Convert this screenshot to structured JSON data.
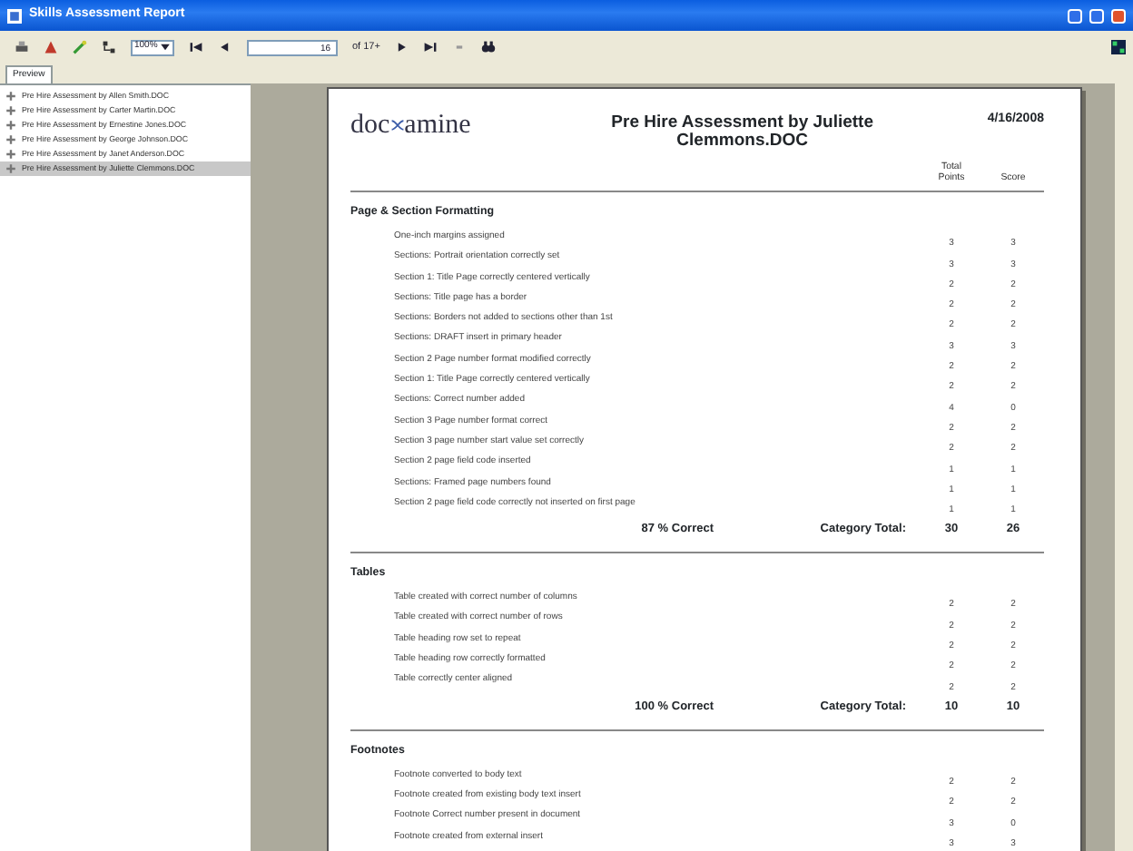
{
  "window": {
    "title": "Skills Assessment Report"
  },
  "toolbar": {
    "zoom": "100%",
    "page_number": "16",
    "page_count": "of 17+"
  },
  "tabs": [
    {
      "label": "Preview",
      "selected": true
    }
  ],
  "documents": [
    {
      "label": "Pre Hire Assessment by Allen Smith.DOC",
      "selected": false
    },
    {
      "label": "Pre Hire Assessment by Carter Martin.DOC",
      "selected": false
    },
    {
      "label": "Pre Hire Assessment by Ernestine Jones.DOC",
      "selected": false
    },
    {
      "label": "Pre Hire Assessment by George Johnson.DOC",
      "selected": false
    },
    {
      "label": "Pre Hire Assessment by Janet Anderson.DOC",
      "selected": false
    },
    {
      "label": "Pre Hire Assessment by Juliette Clemmons.DOC",
      "selected": true
    }
  ],
  "report": {
    "logo_left": "doc",
    "logo_right": "amine",
    "title": "Pre Hire Assessment by Juliette Clemmons.DOC",
    "date": "4/16/2008",
    "columns": [
      "Total Points",
      "Score"
    ],
    "sections": [
      {
        "title": "Page & Section Formatting",
        "percent": "87 % Correct",
        "total_label": "Category Total:",
        "total_points": "30",
        "total_score": "26",
        "items": [
          {
            "label": "One-inch margins assigned",
            "points": "3",
            "score": "3"
          },
          {
            "label": "Sections: Portrait orientation correctly set",
            "points": "3",
            "score": "3"
          },
          {
            "label": "Section 1: Title Page correctly centered vertically",
            "points": "2",
            "score": "2"
          },
          {
            "label": "Sections: Title page has a border",
            "points": "2",
            "score": "2"
          },
          {
            "label": "Sections: Borders not added to sections other than 1st",
            "points": "2",
            "score": "2"
          },
          {
            "label": "Sections: DRAFT insert in primary header",
            "points": "3",
            "score": "3"
          },
          {
            "label": "Section 2 Page number format modified correctly",
            "points": "2",
            "score": "2"
          },
          {
            "label": "Section 1: Title Page correctly centered vertically",
            "points": "2",
            "score": "2"
          },
          {
            "label": "Sections: Correct number added",
            "points": "4",
            "score": "0"
          },
          {
            "label": "Section 3 Page number format correct",
            "points": "2",
            "score": "2"
          },
          {
            "label": "Section 3 page number start value set correctly",
            "points": "2",
            "score": "2"
          },
          {
            "label": "Section 2 page field code inserted",
            "points": "1",
            "score": "1"
          },
          {
            "label": "Sections: Framed page numbers found",
            "points": "1",
            "score": "1"
          },
          {
            "label": "Section 2 page field code correctly not inserted on first page",
            "points": "1",
            "score": "1"
          }
        ]
      },
      {
        "title": "Tables",
        "percent": "100 % Correct",
        "total_label": "Category Total:",
        "total_points": "10",
        "total_score": "10",
        "items": [
          {
            "label": "Table created with correct number of columns",
            "points": "2",
            "score": "2"
          },
          {
            "label": "Table created with correct number of rows",
            "points": "2",
            "score": "2"
          },
          {
            "label": "Table heading row set to repeat",
            "points": "2",
            "score": "2"
          },
          {
            "label": "Table heading row correctly formatted",
            "points": "2",
            "score": "2"
          },
          {
            "label": "Table correctly center aligned",
            "points": "2",
            "score": "2"
          }
        ]
      },
      {
        "title": "Footnotes",
        "items": [
          {
            "label": "Footnote converted to body text",
            "points": "2",
            "score": "2"
          },
          {
            "label": "Footnote created from existing body text insert",
            "points": "2",
            "score": "2"
          },
          {
            "label": "Footnote Correct number present in document",
            "points": "3",
            "score": "0"
          },
          {
            "label": "Footnote created from external insert",
            "points": "3",
            "score": "3"
          }
        ]
      }
    ]
  }
}
